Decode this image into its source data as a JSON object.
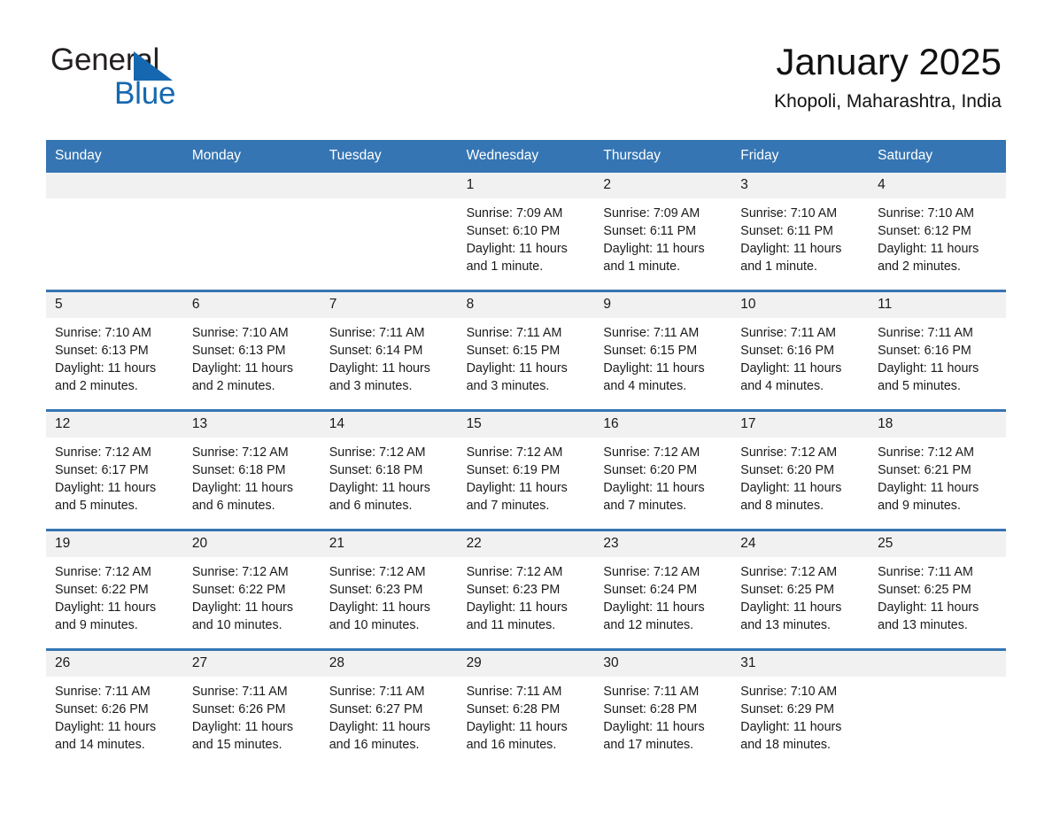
{
  "brand": {
    "name_part1": "General",
    "name_part2": "Blue",
    "flag_icon": "triangle-flag-icon",
    "colors": {
      "blue": "#1568b0",
      "dark": "#231f20"
    }
  },
  "header": {
    "title": "January 2025",
    "subtitle": "Khopoli, Maharashtra, India"
  },
  "theme": {
    "header_blue": "#3575b3",
    "row_divider_blue": "#3575b3",
    "day_band_gray": "#f1f1f1",
    "text_dark": "#1a1a1a"
  },
  "weekdays": [
    "Sunday",
    "Monday",
    "Tuesday",
    "Wednesday",
    "Thursday",
    "Friday",
    "Saturday"
  ],
  "weeks": [
    [
      {
        "empty": true
      },
      {
        "empty": true
      },
      {
        "empty": true
      },
      {
        "day": "1",
        "sunrise": "Sunrise: 7:09 AM",
        "sunset": "Sunset: 6:10 PM",
        "daylight": "Daylight: 11 hours and 1 minute."
      },
      {
        "day": "2",
        "sunrise": "Sunrise: 7:09 AM",
        "sunset": "Sunset: 6:11 PM",
        "daylight": "Daylight: 11 hours and 1 minute."
      },
      {
        "day": "3",
        "sunrise": "Sunrise: 7:10 AM",
        "sunset": "Sunset: 6:11 PM",
        "daylight": "Daylight: 11 hours and 1 minute."
      },
      {
        "day": "4",
        "sunrise": "Sunrise: 7:10 AM",
        "sunset": "Sunset: 6:12 PM",
        "daylight": "Daylight: 11 hours and 2 minutes."
      }
    ],
    [
      {
        "day": "5",
        "sunrise": "Sunrise: 7:10 AM",
        "sunset": "Sunset: 6:13 PM",
        "daylight": "Daylight: 11 hours and 2 minutes."
      },
      {
        "day": "6",
        "sunrise": "Sunrise: 7:10 AM",
        "sunset": "Sunset: 6:13 PM",
        "daylight": "Daylight: 11 hours and 2 minutes."
      },
      {
        "day": "7",
        "sunrise": "Sunrise: 7:11 AM",
        "sunset": "Sunset: 6:14 PM",
        "daylight": "Daylight: 11 hours and 3 minutes."
      },
      {
        "day": "8",
        "sunrise": "Sunrise: 7:11 AM",
        "sunset": "Sunset: 6:15 PM",
        "daylight": "Daylight: 11 hours and 3 minutes."
      },
      {
        "day": "9",
        "sunrise": "Sunrise: 7:11 AM",
        "sunset": "Sunset: 6:15 PM",
        "daylight": "Daylight: 11 hours and 4 minutes."
      },
      {
        "day": "10",
        "sunrise": "Sunrise: 7:11 AM",
        "sunset": "Sunset: 6:16 PM",
        "daylight": "Daylight: 11 hours and 4 minutes."
      },
      {
        "day": "11",
        "sunrise": "Sunrise: 7:11 AM",
        "sunset": "Sunset: 6:16 PM",
        "daylight": "Daylight: 11 hours and 5 minutes."
      }
    ],
    [
      {
        "day": "12",
        "sunrise": "Sunrise: 7:12 AM",
        "sunset": "Sunset: 6:17 PM",
        "daylight": "Daylight: 11 hours and 5 minutes."
      },
      {
        "day": "13",
        "sunrise": "Sunrise: 7:12 AM",
        "sunset": "Sunset: 6:18 PM",
        "daylight": "Daylight: 11 hours and 6 minutes."
      },
      {
        "day": "14",
        "sunrise": "Sunrise: 7:12 AM",
        "sunset": "Sunset: 6:18 PM",
        "daylight": "Daylight: 11 hours and 6 minutes."
      },
      {
        "day": "15",
        "sunrise": "Sunrise: 7:12 AM",
        "sunset": "Sunset: 6:19 PM",
        "daylight": "Daylight: 11 hours and 7 minutes."
      },
      {
        "day": "16",
        "sunrise": "Sunrise: 7:12 AM",
        "sunset": "Sunset: 6:20 PM",
        "daylight": "Daylight: 11 hours and 7 minutes."
      },
      {
        "day": "17",
        "sunrise": "Sunrise: 7:12 AM",
        "sunset": "Sunset: 6:20 PM",
        "daylight": "Daylight: 11 hours and 8 minutes."
      },
      {
        "day": "18",
        "sunrise": "Sunrise: 7:12 AM",
        "sunset": "Sunset: 6:21 PM",
        "daylight": "Daylight: 11 hours and 9 minutes."
      }
    ],
    [
      {
        "day": "19",
        "sunrise": "Sunrise: 7:12 AM",
        "sunset": "Sunset: 6:22 PM",
        "daylight": "Daylight: 11 hours and 9 minutes."
      },
      {
        "day": "20",
        "sunrise": "Sunrise: 7:12 AM",
        "sunset": "Sunset: 6:22 PM",
        "daylight": "Daylight: 11 hours and 10 minutes."
      },
      {
        "day": "21",
        "sunrise": "Sunrise: 7:12 AM",
        "sunset": "Sunset: 6:23 PM",
        "daylight": "Daylight: 11 hours and 10 minutes."
      },
      {
        "day": "22",
        "sunrise": "Sunrise: 7:12 AM",
        "sunset": "Sunset: 6:23 PM",
        "daylight": "Daylight: 11 hours and 11 minutes."
      },
      {
        "day": "23",
        "sunrise": "Sunrise: 7:12 AM",
        "sunset": "Sunset: 6:24 PM",
        "daylight": "Daylight: 11 hours and 12 minutes."
      },
      {
        "day": "24",
        "sunrise": "Sunrise: 7:12 AM",
        "sunset": "Sunset: 6:25 PM",
        "daylight": "Daylight: 11 hours and 13 minutes."
      },
      {
        "day": "25",
        "sunrise": "Sunrise: 7:11 AM",
        "sunset": "Sunset: 6:25 PM",
        "daylight": "Daylight: 11 hours and 13 minutes."
      }
    ],
    [
      {
        "day": "26",
        "sunrise": "Sunrise: 7:11 AM",
        "sunset": "Sunset: 6:26 PM",
        "daylight": "Daylight: 11 hours and 14 minutes."
      },
      {
        "day": "27",
        "sunrise": "Sunrise: 7:11 AM",
        "sunset": "Sunset: 6:26 PM",
        "daylight": "Daylight: 11 hours and 15 minutes."
      },
      {
        "day": "28",
        "sunrise": "Sunrise: 7:11 AM",
        "sunset": "Sunset: 6:27 PM",
        "daylight": "Daylight: 11 hours and 16 minutes."
      },
      {
        "day": "29",
        "sunrise": "Sunrise: 7:11 AM",
        "sunset": "Sunset: 6:28 PM",
        "daylight": "Daylight: 11 hours and 16 minutes."
      },
      {
        "day": "30",
        "sunrise": "Sunrise: 7:11 AM",
        "sunset": "Sunset: 6:28 PM",
        "daylight": "Daylight: 11 hours and 17 minutes."
      },
      {
        "day": "31",
        "sunrise": "Sunrise: 7:10 AM",
        "sunset": "Sunset: 6:29 PM",
        "daylight": "Daylight: 11 hours and 18 minutes."
      },
      {
        "empty": true
      }
    ]
  ]
}
